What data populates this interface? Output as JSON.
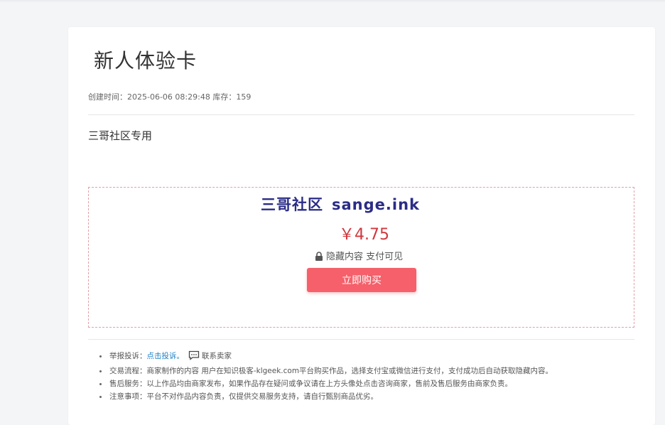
{
  "product": {
    "title": "新人体验卡",
    "meta": "创建时间：2025-06-06 08:29:48 库存：159",
    "description": "三哥社区专用"
  },
  "payment": {
    "banner_cn": "三哥社区",
    "banner_en": "sange.ink",
    "price": "￥4.75",
    "hidden_note": "隐藏内容 支付可见",
    "buy_button": "立即购买",
    "accent_color": "#f5606a",
    "price_color": "#d0383d",
    "banner_color": "#2a2c86"
  },
  "notes": {
    "report_label": "举报投诉：",
    "report_link": "点击投诉。",
    "contact_seller": "联系卖家",
    "process": "交易流程：商家制作的内容 用户在知识极客-klgeek.com平台购买作品，选择支付宝或微信进行支付，支付成功后自动获取隐藏内容。",
    "after_sales": "售后服务：以上作品均由商家发布，如果作品存在疑问或争议请在上方头像处点击咨询商家，售前及售后服务由商家负责。",
    "caution": "注意事项：平台不对作品内容负责，仅提供交易服务支持，请自行甄别商品优劣。"
  },
  "icons": {
    "lock": "lock-icon",
    "chat": "chat-bubble-icon"
  }
}
